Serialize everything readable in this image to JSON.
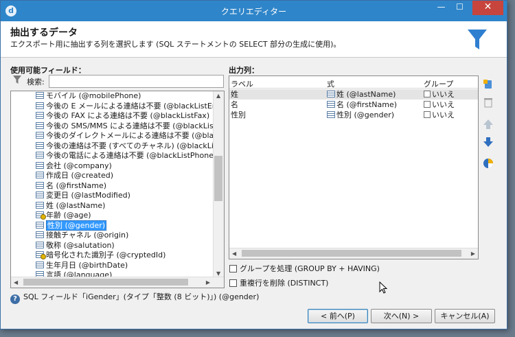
{
  "window": {
    "title": "クエリエディター",
    "app_icon": "d"
  },
  "titlebar_buttons": {
    "minimize": "—",
    "maximize": "☐",
    "close": "✕"
  },
  "header": {
    "title": "抽出するデータ",
    "description": "エクスポート用に抽出する列を選択します (SQL ステートメントの SELECT 部分の生成に使用)。"
  },
  "left_panel": {
    "label": "使用可能フィールド：",
    "search_label": "検索:",
    "search_value": "",
    "fields": [
      {
        "text": "モバイル (@mobilePhone)"
      },
      {
        "text": "今後の E メールによる連絡は不要 (@blackListEmail)"
      },
      {
        "text": "今後の FAX による連絡は不要 (@blackListFax)"
      },
      {
        "text": "今後の SMS/MMS による連絡は不要 (@blackListMobile)"
      },
      {
        "text": "今後のダイレクトメールによる連絡は不要 (@blackListPostalMail)"
      },
      {
        "text": "今後の連絡は不要 (すべてのチャネル) (@blackList)"
      },
      {
        "text": "今後の電話による連絡は不要 (@blackListPhone)"
      },
      {
        "text": "会社 (@company)"
      },
      {
        "text": "作成日 (@created)"
      },
      {
        "text": "名 (@firstName)"
      },
      {
        "text": "変更日 (@lastModified)"
      },
      {
        "text": "姓 (@lastName)"
      },
      {
        "text": "年齢 (@age)",
        "key": true
      },
      {
        "text": "性別 (@gender)",
        "selected": true
      },
      {
        "text": "接触チャネル (@origin)"
      },
      {
        "text": "敬称 (@salutation)"
      },
      {
        "text": "暗号化された識別子 (@cryptedId)",
        "key": true
      },
      {
        "text": "生年月日 (@birthDate)"
      },
      {
        "text": "言語 (@language)"
      }
    ]
  },
  "right_panel": {
    "label": "出力列：",
    "columns": {
      "label": "ラベル",
      "expression": "式",
      "group": "グループ"
    },
    "rows": [
      {
        "label": "姓",
        "expression": "姓 (@lastName)",
        "group": "いいえ"
      },
      {
        "label": "名",
        "expression": "名 (@firstName)",
        "group": "いいえ"
      },
      {
        "label": "性別",
        "expression": "性別 (@gender)",
        "group": "いいえ"
      }
    ]
  },
  "options": {
    "group_by": "グループを処理 (GROUP BY + HAVING)",
    "distinct": "重複行を削除 (DISTINCT)"
  },
  "status_text": "SQL フィールド「iGender」(タイプ「整数 (8 ビット)」) (@gender)",
  "buttons": {
    "prev": "< 前へ(P)",
    "next": "次へ(N) >",
    "cancel": "キャンセル(A)"
  },
  "colors": {
    "titlebar": "#2f85c9",
    "selection": "#3399ff",
    "close": "#c7453d"
  }
}
